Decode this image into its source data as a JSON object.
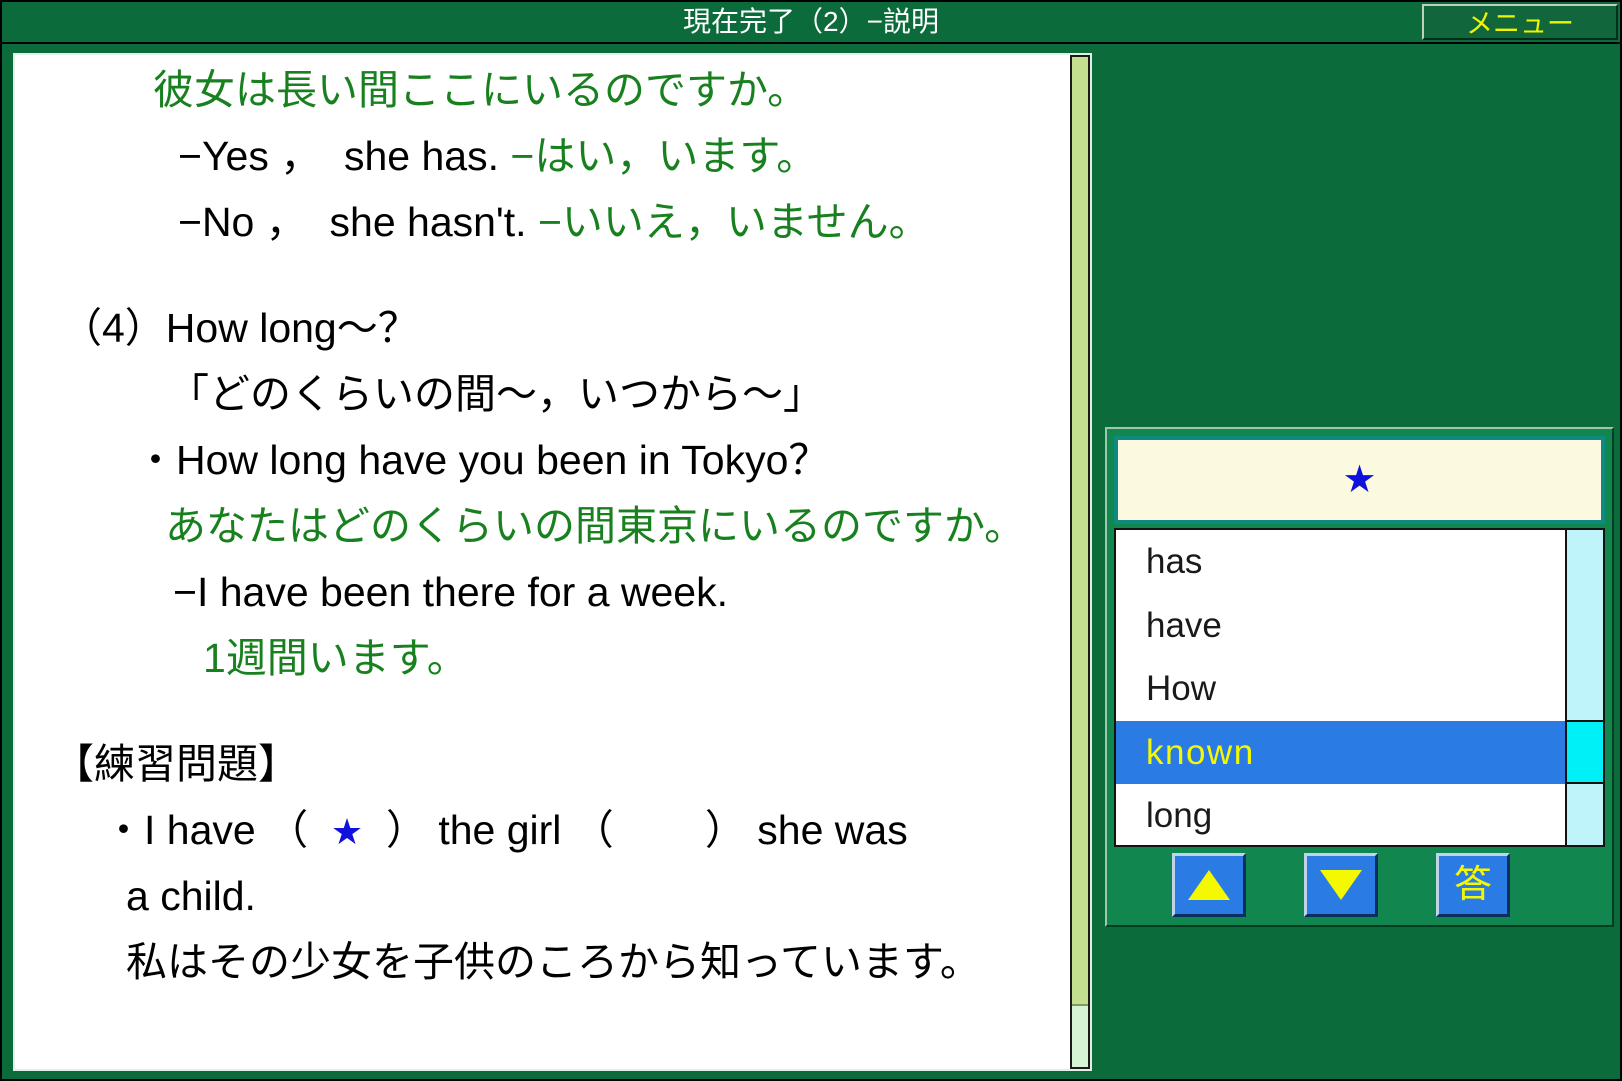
{
  "titlebar": {
    "title": "現在完了（2）−説明",
    "menu_label": "メニュー"
  },
  "content": {
    "lines": [
      {
        "id": "l1",
        "indent": 140,
        "parts": [
          {
            "text": "彼女は長い間ここにいるのですか。",
            "color": "green"
          }
        ]
      },
      {
        "id": "l2",
        "indent": 165,
        "parts": [
          {
            "text": "−Yes ，  she has. ",
            "color": "black"
          },
          {
            "text": "−はい，います。",
            "color": "green"
          }
        ]
      },
      {
        "id": "l3",
        "indent": 165,
        "parts": [
          {
            "text": "−No ，  she hasn't. ",
            "color": "black"
          },
          {
            "text": "−いいえ，いません。",
            "color": "green"
          }
        ]
      },
      {
        "id": "l4",
        "indent": 0,
        "blank": true,
        "parts": []
      },
      {
        "id": "l5",
        "indent": 48,
        "parts": [
          {
            "text": "（4）How long〜？",
            "color": "black"
          }
        ]
      },
      {
        "id": "l6",
        "indent": 155,
        "parts": [
          {
            "text": "「どのくらいの間〜，いつから〜」",
            "color": "black"
          }
        ]
      },
      {
        "id": "l7",
        "indent": 122,
        "parts": [
          {
            "text": "・How long have you been in Tokyo？",
            "color": "black"
          }
        ]
      },
      {
        "id": "l8",
        "indent": 152,
        "parts": [
          {
            "text": "あなたはどのくらいの間東京にいるのですか。",
            "color": "green"
          }
        ]
      },
      {
        "id": "l9",
        "indent": 160,
        "parts": [
          {
            "text": "−I have been there for a week.",
            "color": "black"
          }
        ]
      },
      {
        "id": "l10",
        "indent": 190,
        "parts": [
          {
            "text": "1週間います。",
            "color": "green"
          }
        ]
      },
      {
        "id": "l11",
        "indent": 0,
        "blank": true,
        "parts": []
      },
      {
        "id": "l12",
        "indent": 40,
        "parts": [
          {
            "text": "【練習問題】",
            "color": "black"
          }
        ]
      },
      {
        "id": "l13",
        "indent": 90,
        "parts": [
          {
            "text": "・I have （  ",
            "color": "black"
          },
          {
            "text": "★",
            "color": "star"
          },
          {
            "text": "  ） the girl （        ） she was",
            "color": "black"
          }
        ]
      },
      {
        "id": "l14",
        "indent": 113,
        "parts": [
          {
            "text": "a child.",
            "color": "black"
          }
        ]
      },
      {
        "id": "l15",
        "indent": 113,
        "parts": [
          {
            "text": "私はその少女を子供のころから知っています。",
            "color": "black"
          }
        ]
      }
    ]
  },
  "quiz": {
    "answer_display": "★",
    "words": [
      {
        "label": "has",
        "selected": false
      },
      {
        "label": "have",
        "selected": false
      },
      {
        "label": "How",
        "selected": false
      },
      {
        "label": "known",
        "selected": true
      },
      {
        "label": "long",
        "selected": false
      }
    ],
    "buttons": {
      "up_label": "▲",
      "down_label": "▼",
      "answer_label": "答"
    }
  },
  "colors": {
    "frame_green": "#0B6B3A",
    "jp_green": "#18801E",
    "star_blue": "#1111DD",
    "select_blue": "#2B7BE4",
    "select_text": "#F5F900",
    "menu_yellow": "#EEF500",
    "cream": "#FBFAE0",
    "scroll_cyan": "#00F0F8"
  }
}
